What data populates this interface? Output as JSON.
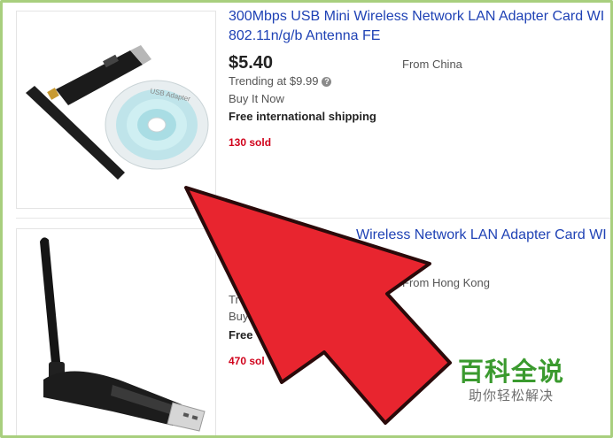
{
  "listings": [
    {
      "title_line1": "300Mbps USB Mini Wireless Network LAN Adapter Card WI",
      "title_line2": "802.11n/g/b Antenna FE",
      "price": "$5.40",
      "origin": "From China",
      "trending": "Trending at $9.99",
      "trending_icon": "info-icon",
      "format": "Buy It Now",
      "shipping": "Free international shipping",
      "sold": "130 sold",
      "disc_label": "USB Adapter"
    },
    {
      "title_visible": "Wireless Network LAN Adapter Card WI",
      "origin": "From Hong Kong",
      "trending_partial": "Tr",
      "format_partial": "Buy",
      "shipping_partial": "Free",
      "sold_partial": "470 sol"
    }
  ],
  "watermark": {
    "title": "百科全说",
    "subtitle": "助你轻松解决"
  },
  "colors": {
    "link": "#1f42b5",
    "sold": "#d0021b",
    "arrow": "#e8252f",
    "frame": "#a8cf7e",
    "watermark": "#3a9a2e"
  }
}
